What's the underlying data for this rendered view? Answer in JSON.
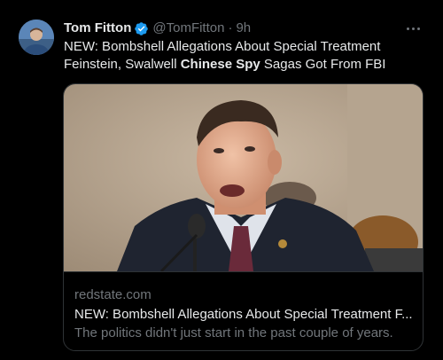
{
  "tweet": {
    "author_name": "Tom Fitton",
    "handle": "@TomFitton",
    "separator": "·",
    "time": "9h",
    "text_line1": "NEW: Bombshell Allegations About Special Treatment",
    "text_line2_before": "Feinstein, Swalwell ",
    "text_line2_bold": "Chinese Spy",
    "text_line2_after": " Sagas Got From FBI",
    "verified": true
  },
  "card": {
    "domain": "redstate.com",
    "title": "NEW: Bombshell Allegations About Special Treatment F...",
    "description": "The politics didn't just start in the past couple of years."
  },
  "icons": {
    "verified": "verified-badge-icon",
    "more": "more-options-icon"
  },
  "colors": {
    "background": "#000000",
    "primary_text": "#e7e9ea",
    "secondary_text": "#71767b",
    "verified_blue": "#1d9bf0",
    "border": "#2f3336"
  }
}
